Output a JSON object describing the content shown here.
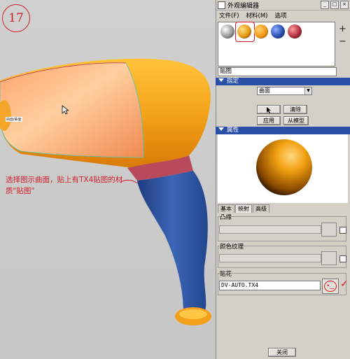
{
  "annotation": {
    "step_number": "17",
    "instruction": "选择图示曲面，贴上有TX4贴图的材质\"贴图\"",
    "surface_label": "曲面/曲面"
  },
  "panel": {
    "title": "外观编辑器",
    "menu": [
      "文件(F)",
      "材料(M)",
      "选项"
    ],
    "add_button": "+",
    "remove_button": "−",
    "appearance_name": "贴图",
    "assign_section": {
      "header": "指定",
      "type_value": "曲面",
      "clear_label": "清除",
      "apply_label": "应用",
      "from_model_label": "从模型"
    },
    "properties_section": {
      "header": "属性",
      "tabs": [
        "基本",
        "映射",
        "高级"
      ],
      "active_tab": "映射",
      "bump_label": "凸缘",
      "color_texture_label": "颜色纹理",
      "decal_label": "贴花",
      "decal_file": "DV-AUTO.TX4"
    },
    "close_label": "关闭"
  },
  "colors": {
    "accent_red": "#d0202a",
    "section_blue": "#2b4fa6",
    "orange": "#f2a21a",
    "handle_blue": "#2c4f9a",
    "band_red": "#b84a5c",
    "selected_surface": "#ffb784"
  },
  "icons": [
    "pointer-icon",
    "decal-stamp-icon",
    "checkmark-icon"
  ]
}
